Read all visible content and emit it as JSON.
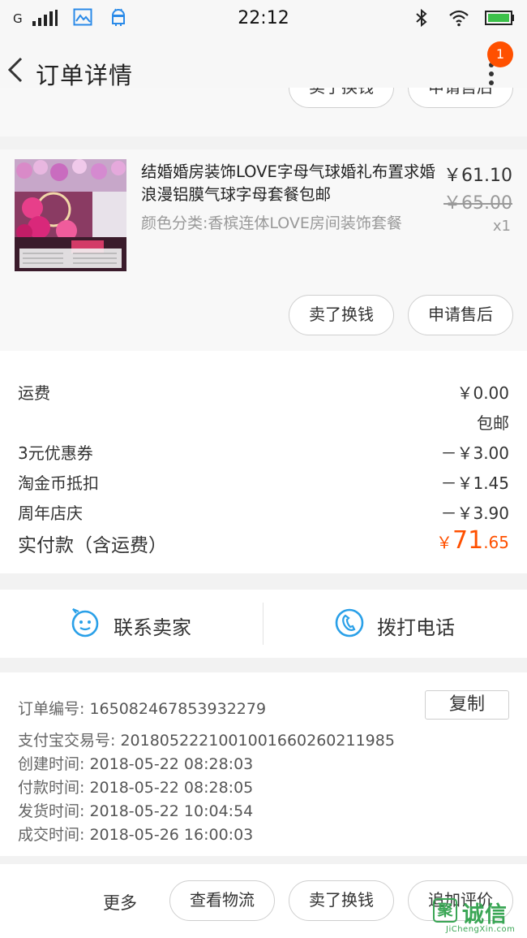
{
  "status_bar": {
    "carrier": "G",
    "time": "22:12",
    "icons": [
      "signal-icon",
      "image-icon",
      "android-icon",
      "bluetooth-icon",
      "wifi-icon",
      "battery-icon"
    ]
  },
  "nav": {
    "title": "订单详情",
    "badge_count": "1",
    "icons": [
      "back-arrow-icon",
      "more-vertical-icon"
    ]
  },
  "prev_item_actions": {
    "sell_label": "卖了换钱",
    "aftersale_label": "申请售后"
  },
  "product": {
    "title": "结婚婚房装饰LOVE字母气球婚礼布置求婚浪漫铝膜气球字母套餐包邮",
    "sku": "颜色分类:香槟连体LOVE房间装饰套餐",
    "price": "￥61.10",
    "original_price": "￥65.00",
    "quantity": "x1",
    "thumbnail_icon": "balloon-decoration-photo",
    "actions": {
      "sell_label": "卖了换钱",
      "aftersale_label": "申请售后"
    }
  },
  "fees": {
    "rows": [
      {
        "label": "运费",
        "value": "￥0.00"
      },
      {
        "label": "",
        "value": "包邮"
      },
      {
        "label": "3元优惠券",
        "value": "－￥3.00"
      },
      {
        "label": "淘金币抵扣",
        "value": "－￥1.45"
      },
      {
        "label": "周年店庆",
        "value": "－￥3.90"
      }
    ],
    "paid_label": "实付款（含运费）",
    "paid_currency": "￥",
    "paid_integer": "71",
    "paid_decimal": ".65",
    "accent_color": "#ff5000"
  },
  "contact": {
    "seller_label": "联系卖家",
    "phone_label": "拨打电话",
    "icon_color": "#2aa0e8"
  },
  "order_info": {
    "copy_label": "复制",
    "lines": [
      {
        "label": "订单编号:",
        "value": "165082467853932279"
      },
      {
        "label": "支付宝交易号:",
        "value": "2018052221001001660260211985"
      },
      {
        "label": "创建时间:",
        "value": "2018-05-22 08:28:03"
      },
      {
        "label": "付款时间:",
        "value": "2018-05-22 08:28:05"
      },
      {
        "label": "发货时间:",
        "value": "2018-05-22 10:04:54"
      },
      {
        "label": "成交时间:",
        "value": "2018-05-26 16:00:03"
      }
    ]
  },
  "bottom_bar": {
    "more_label": "更多",
    "logistics_label": "查看物流",
    "sell_label": "卖了换钱",
    "review_label": "追加评价"
  },
  "watermark": {
    "badge": "聚",
    "text": "诚信",
    "url": "JiChengXin.com"
  }
}
